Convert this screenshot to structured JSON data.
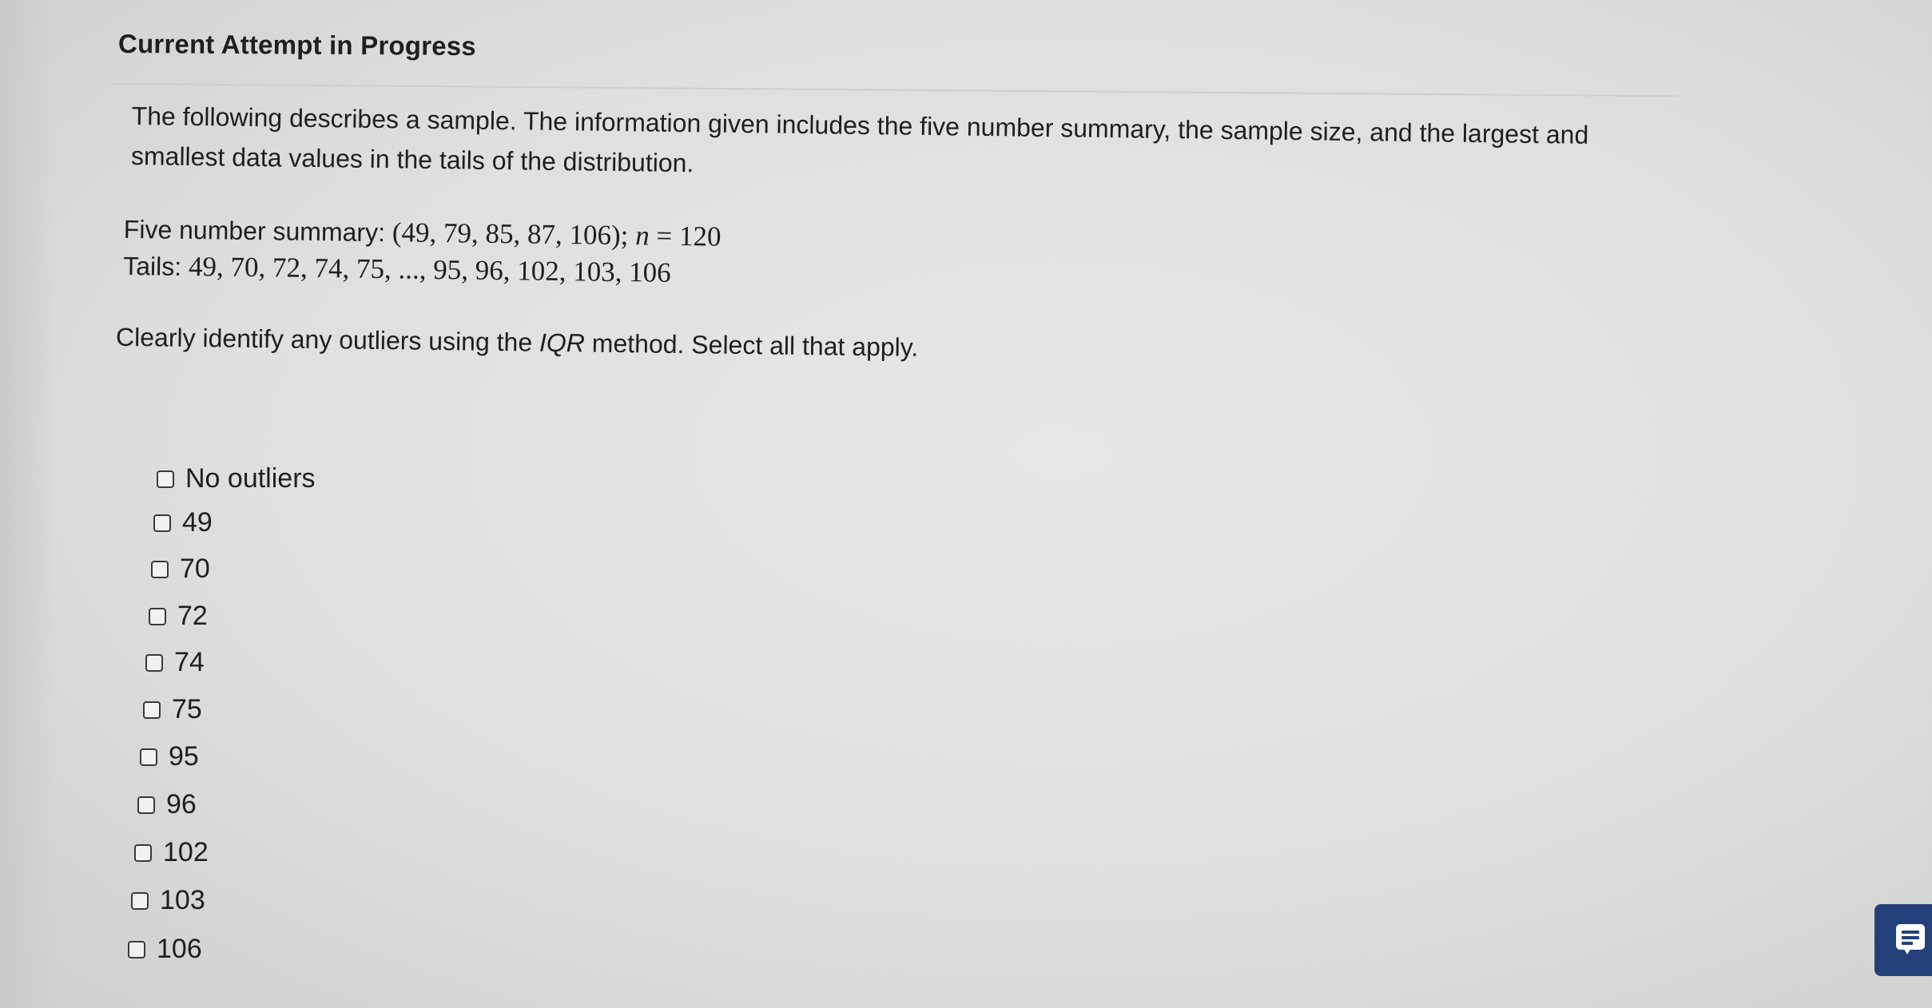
{
  "header": {
    "title": "Current Attempt in Progress"
  },
  "question": {
    "intro_line1": "The following describes a sample. The information given includes the five number summary, the sample size, and the largest and",
    "intro_line2": "smallest data values in the tails of the distribution.",
    "summary_label": "Five number summary:",
    "summary_values": "(49, 79, 85, 87, 106);",
    "n_symbol": "n",
    "n_equals": " = 120",
    "tails_label": "Tails:",
    "tails_values": "49, 70, 72, 74, 75, ..., 95, 96, 102, 103, 106",
    "instruction_before": "Clearly identify any outliers using the ",
    "instruction_em": "IQR",
    "instruction_after": " method. Select all that apply."
  },
  "options": [
    {
      "label": "No outliers",
      "checked": false
    },
    {
      "label": "49",
      "checked": false
    },
    {
      "label": "70",
      "checked": false
    },
    {
      "label": "72",
      "checked": false
    },
    {
      "label": "74",
      "checked": false
    },
    {
      "label": "75",
      "checked": false
    },
    {
      "label": "95",
      "checked": false
    },
    {
      "label": "96",
      "checked": false
    },
    {
      "label": "102",
      "checked": false
    },
    {
      "label": "103",
      "checked": false
    },
    {
      "label": "106",
      "checked": false
    }
  ],
  "chat_button": {
    "icon": "chat-icon",
    "color": "#23407a"
  }
}
